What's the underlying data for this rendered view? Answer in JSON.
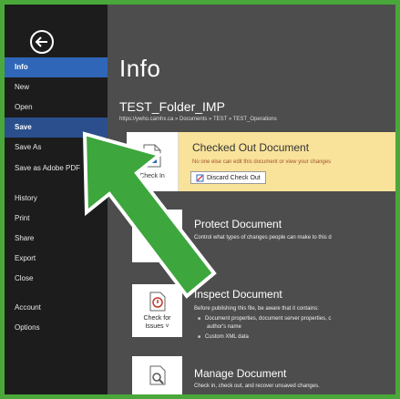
{
  "menu": {
    "items": [
      {
        "label": "Info"
      },
      {
        "label": "New"
      },
      {
        "label": "Open"
      },
      {
        "label": "Save"
      },
      {
        "label": "Save As"
      },
      {
        "label": "Save as Adobe PDF"
      },
      {
        "label": "History"
      },
      {
        "label": "Print"
      },
      {
        "label": "Share"
      },
      {
        "label": "Export"
      },
      {
        "label": "Close"
      },
      {
        "label": "Account"
      },
      {
        "label": "Options"
      }
    ]
  },
  "page": {
    "title": "Info",
    "folder": "TEST_Folder_IMP",
    "path": "https://ywho.camhx.ca » Documents » TEST » TEST_Operations"
  },
  "checked_out": {
    "button": "Check In",
    "title": "Checked Out Document",
    "subtitle": "No one else can edit this document or view your changes",
    "discard": "Discard Check Out"
  },
  "protect": {
    "title": "Protect Document",
    "subtitle": "Control what types of changes people can make to this d"
  },
  "inspect": {
    "button_line1": "Check for",
    "button_line2": "Issues ˅",
    "title": "Inspect Document",
    "subtitle": "Before publishing this file, be aware that it contains:",
    "bullet1": "Document properties, document server properties, c",
    "bullet1b": "author's name",
    "bullet2": "Custom XML data"
  },
  "manage": {
    "title": "Manage Document",
    "subtitle": "Check in, check out, and recover unsaved changes."
  },
  "colors": {
    "green_border": "#4aa83a",
    "sidebar": "#1c1c1c",
    "active": "#2f66b8",
    "checked_bg": "#f9e29a"
  }
}
